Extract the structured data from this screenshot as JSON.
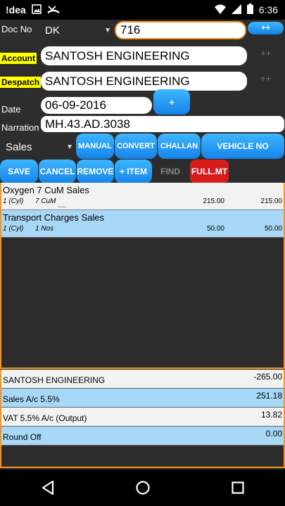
{
  "status_bar": {
    "app_name": "!dea",
    "time": "6:36",
    "icons": [
      "image-icon",
      "missed-call-icon",
      "wifi-icon",
      "signal-icon",
      "battery-icon"
    ]
  },
  "doc": {
    "label": "Doc No",
    "series": "DK",
    "number": "716",
    "plus_button": "++"
  },
  "account": {
    "label": "Account",
    "value": "SANTOSH ENGINEERING",
    "plus": "++"
  },
  "despatch": {
    "label": "Despatch",
    "value": "SANTOSH ENGINEERING",
    "plus": "++"
  },
  "date": {
    "label": "Date",
    "value": "06-09-2016",
    "plus_button": "+"
  },
  "narration": {
    "label": "Narration",
    "value": "MH.43.AD.3038"
  },
  "type_row": {
    "selected": "Sales",
    "buttons": [
      "MANUAL",
      "CONVERT",
      "CHALLAN",
      "VEHICLE NO"
    ]
  },
  "action_row": {
    "save": "SAVE",
    "cancel": "CANCEL",
    "remove": "REMOVE",
    "add_item": "+ ITEM",
    "find": "FIND",
    "full_mt": "FULL.MT"
  },
  "items": [
    {
      "name": "Oxygen  7 CuM Sales",
      "qty": "1 (Cyl)",
      "unit": "7 CuM",
      "rate": "215.00",
      "amount": "215.00"
    },
    {
      "name": "Transport Charges  Sales",
      "qty": "1 (Cyl)",
      "unit": "1 Nos",
      "rate": "50.00",
      "amount": "50.00"
    }
  ],
  "ledger": [
    {
      "name": "SANTOSH ENGINEERING",
      "amount": "-265.00"
    },
    {
      "name": "Sales A/c 5.5%",
      "amount": "251.18"
    },
    {
      "name": "VAT 5.5% A/c (Output)",
      "amount": "13.82"
    },
    {
      "name": "Round Off",
      "amount": "0.00"
    }
  ],
  "nav": [
    "back-icon",
    "home-icon",
    "recents-icon"
  ],
  "colors": {
    "accent_orange": "#f7941d",
    "button_blue": "#1e90ff",
    "button_red": "#d81c1c",
    "label_yellow": "#ffff00",
    "row_blue": "#a8d8f8"
  }
}
